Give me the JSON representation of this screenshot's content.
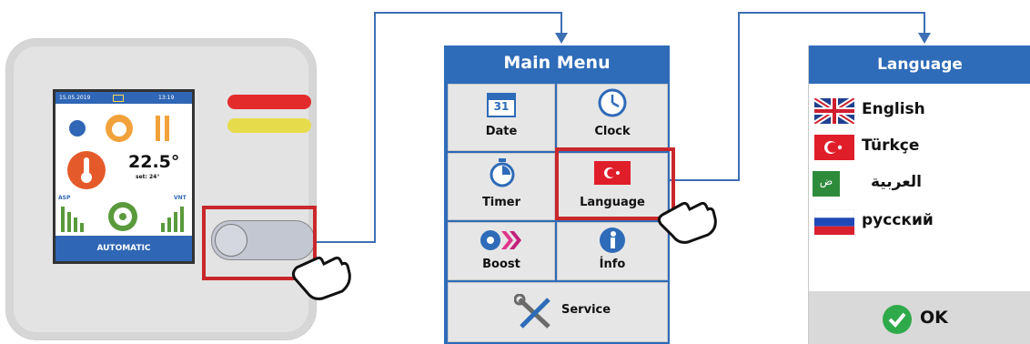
{
  "device": {
    "status_date": "15.05.2019",
    "status_time": "13:19",
    "temperature": "22.5°",
    "setpoint": "set: 24°",
    "label_asp": "ASP",
    "label_vnt": "VNT",
    "mode": "AUTOMATIC"
  },
  "main_menu": {
    "title": "Main Menu",
    "items": [
      {
        "label": "Date",
        "icon": "calendar-icon",
        "icon_text": "31"
      },
      {
        "label": "Clock",
        "icon": "clock-icon"
      },
      {
        "label": "Timer",
        "icon": "timer-icon"
      },
      {
        "label": "Language",
        "icon": "turkey-flag-icon"
      },
      {
        "label": "Boost",
        "icon": "boost-icon"
      },
      {
        "label": "İnfo",
        "icon": "info-icon"
      },
      {
        "label": "Service",
        "icon": "service-tools-icon"
      }
    ]
  },
  "language_menu": {
    "title": "Language",
    "languages": [
      {
        "label": "English",
        "icon": "uk-flag-icon"
      },
      {
        "label": "Türkçe",
        "icon": "turkey-flag-icon"
      },
      {
        "label": "العربية",
        "icon": "arabic-flag-icon",
        "flag_text": "ض"
      },
      {
        "label": "русский",
        "icon": "russia-flag-icon"
      }
    ],
    "ok_label": "OK"
  },
  "colors": {
    "accent_blue": "#2e6bb8",
    "highlight_red": "#c9272b",
    "ok_green": "#2faa4a"
  }
}
